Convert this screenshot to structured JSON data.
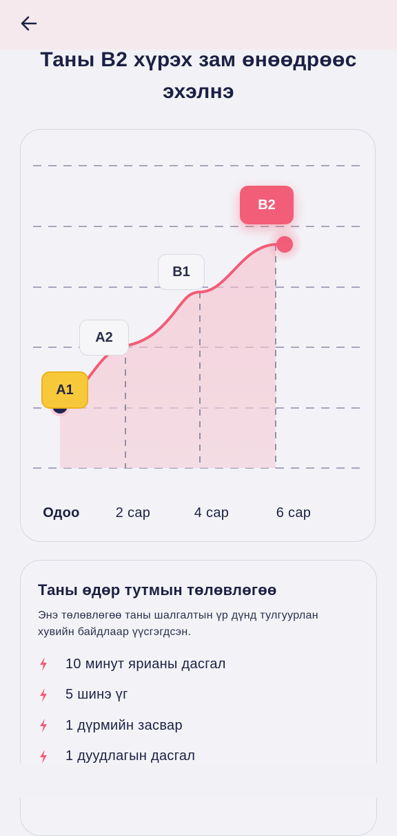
{
  "header": {
    "back_icon": "arrow-left-icon",
    "title": "Таны B2 хүрэх зам өнөөдрөөс эхэлнэ"
  },
  "progress": {
    "levels": {
      "a1": "A1",
      "a2": "A2",
      "b1": "B1",
      "b2": "B2"
    },
    "timeline": {
      "now": "Одоо",
      "m2": "2 сар",
      "m4": "4 сар",
      "m6": "6 сар"
    },
    "colors": {
      "accent": "#f25d77",
      "start": "#f7c93a",
      "grid": "#8a8ca6",
      "dot": "#1f2350"
    }
  },
  "plan": {
    "title": "Таны өдөр тутмын төлөвлөгөө",
    "description": "Энэ төлөвлөгөө таны шалгалтын үр дүнд тулгуурлан хувийн байдлаар үүсгэгдсэн.",
    "items": [
      {
        "icon": "lightning-icon",
        "label": "10 минут ярианы дасгал"
      },
      {
        "icon": "lightning-icon",
        "label": "5 шинэ үг"
      },
      {
        "icon": "lightning-icon",
        "label": "1 дүрмийн засвар"
      },
      {
        "icon": "lightning-icon",
        "label": "1 дуудлагын дасгал"
      }
    ]
  }
}
